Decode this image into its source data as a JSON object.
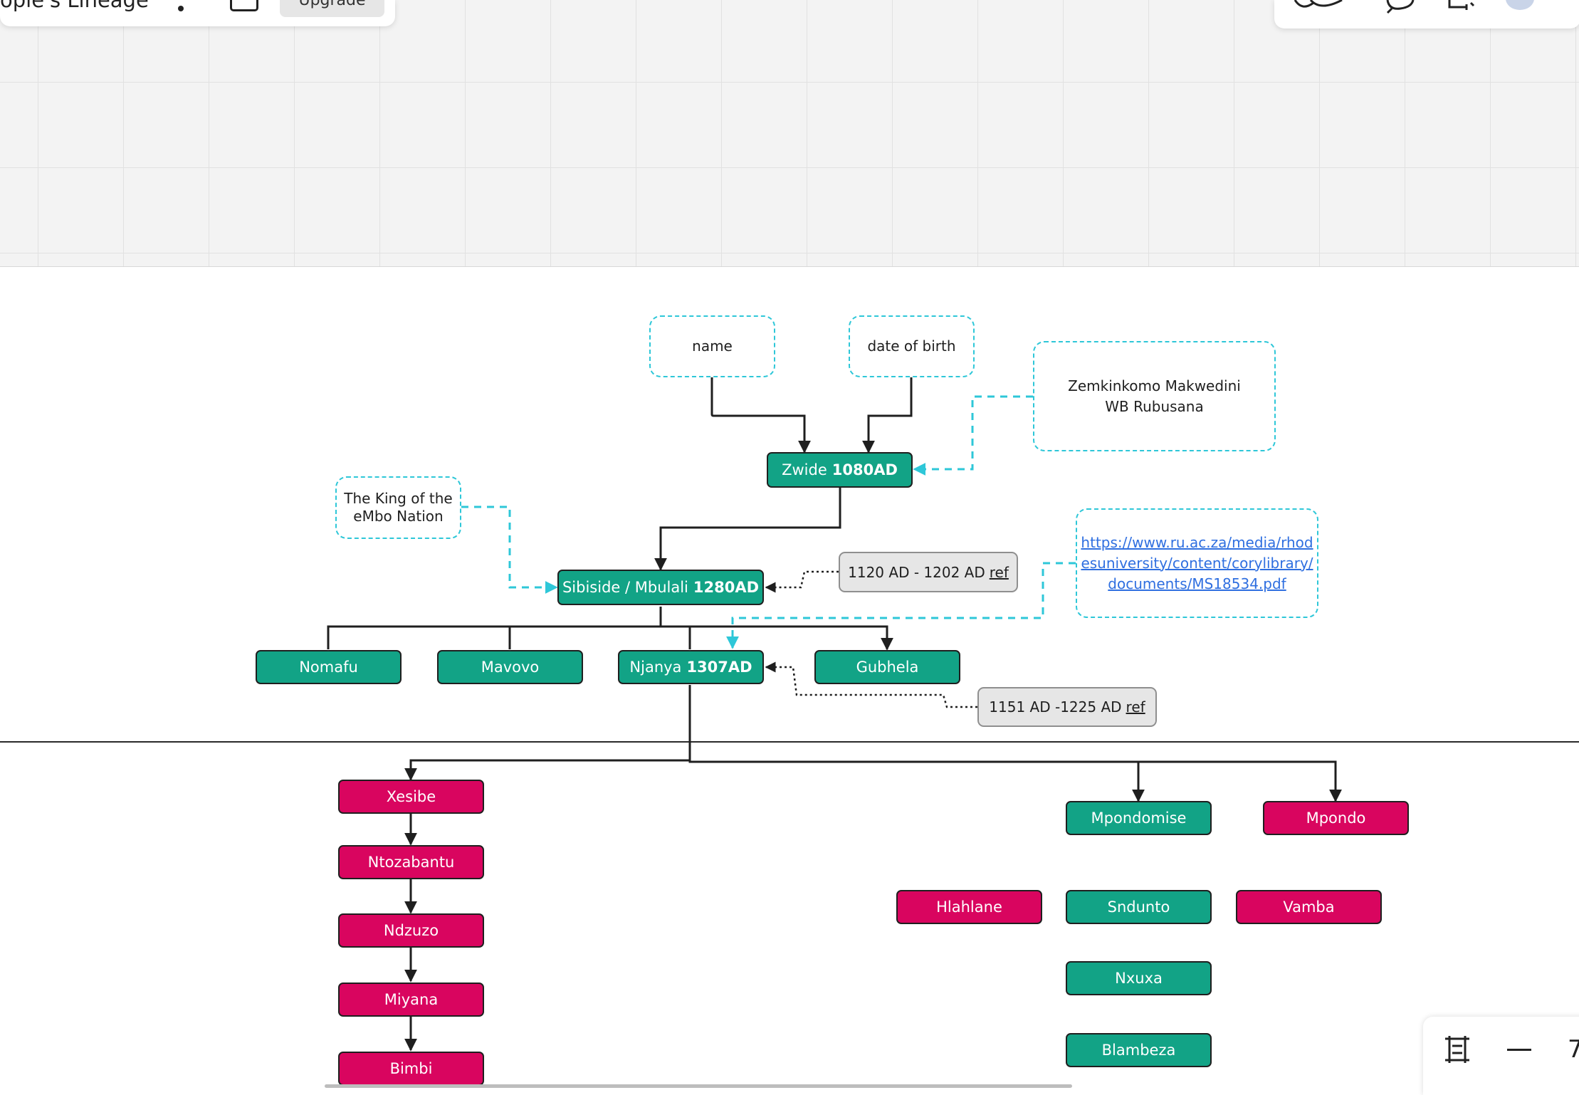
{
  "app": {
    "board_title": "ople's Lineage",
    "upgrade_label": "Upgrade",
    "zoom_level": "7"
  },
  "notes": {
    "name": "name",
    "date_of_birth": "date of birth",
    "source_authors": "Zemkinkomo Makwedini\nWB Rubusana",
    "king_note": "The King of the\neMbo Nation",
    "source_url": "https://www.ru.ac.za/media/rhodesuniversity/content/corylibrary/documents/MS18534.pdf",
    "source_url_lines": [
      "https://www.ru.ac.za/media/rhod",
      "esuniversity/content/corylibrary/",
      "documents/MS18534.pdf"
    ]
  },
  "refs": {
    "sibiside_dates": "1120 AD - 1202 AD",
    "njanya_dates": "1151 AD -1225 AD",
    "link_label": "ref"
  },
  "nodes": {
    "zwide": {
      "name": "Zwide",
      "year": "1080AD"
    },
    "sibiside": {
      "name": "Sibiside / Mbulali",
      "year": "1280AD"
    },
    "nomafu": "Nomafu",
    "mavovo": "Mavovo",
    "njanya": {
      "name": "Njanya",
      "year": "1307AD"
    },
    "gubhela": "Gubhela",
    "xesibe": "Xesibe",
    "ntozabantu": "Ntozabantu",
    "ndzuzo": "Ndzuzo",
    "miyana": "Miyana",
    "bimbi": "Bimbi",
    "mpondomise": "Mpondomise",
    "mpondo": "Mpondo",
    "hlahlane": "Hlahlane",
    "sndunto": "Sndunto",
    "vamba": "Vamba",
    "nxuxa": "Nxuxa",
    "blambeza": "Blambeza"
  },
  "colors": {
    "teal": "#12a386",
    "pink": "#d9055f",
    "note_border": "#2ec7d8",
    "connector": "#1f1f1f"
  },
  "icons": [
    "more-vertical-icon",
    "frame-icon",
    "collaborators-icon",
    "comment-icon",
    "share-icon",
    "avatar",
    "fit-to-screen-icon",
    "zoom-out-icon"
  ]
}
